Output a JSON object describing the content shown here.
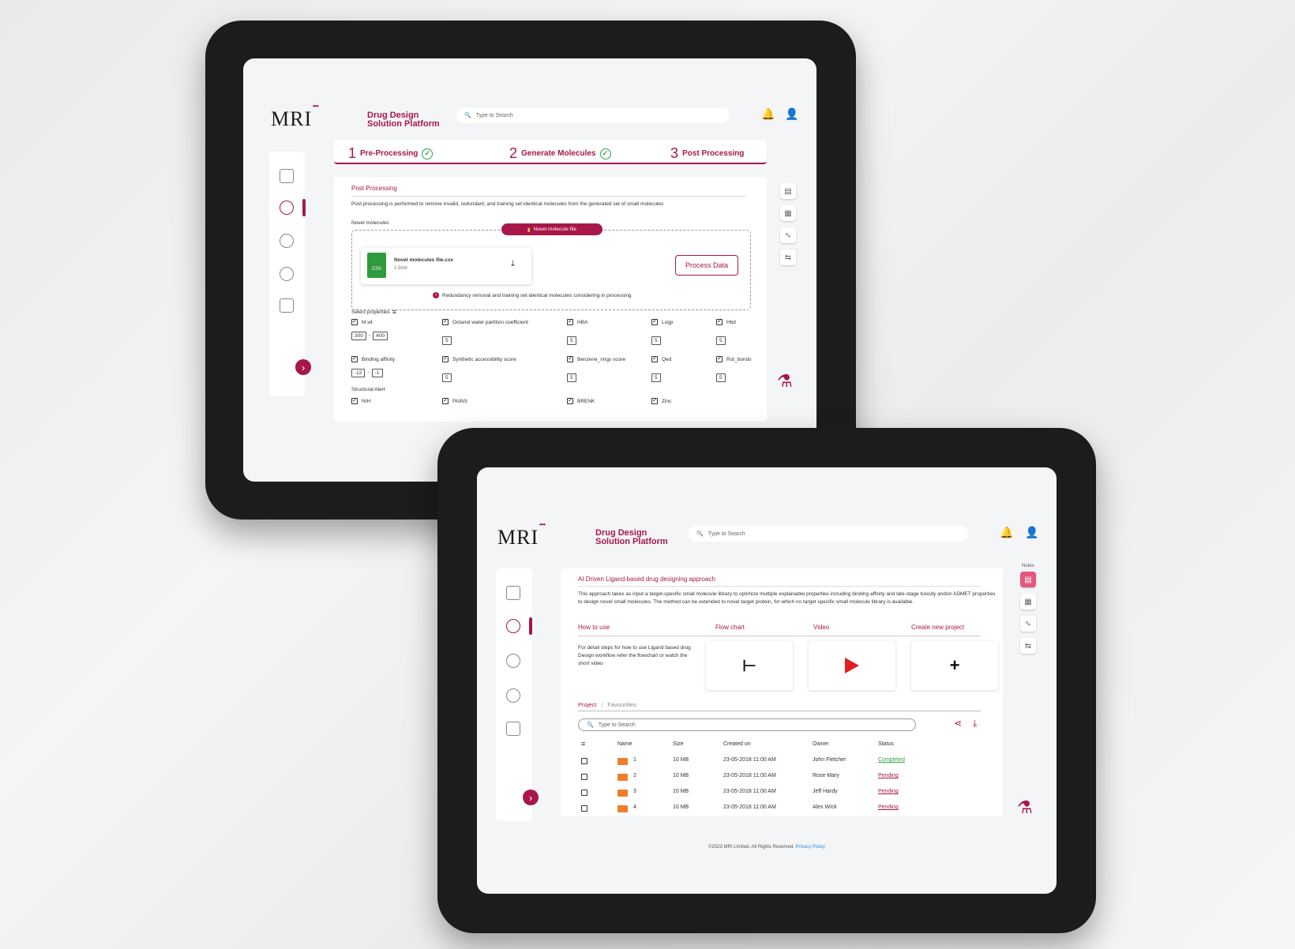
{
  "common": {
    "logo": "MRI",
    "brand_line1": "Drug Design",
    "brand_line2": "Solution Platform",
    "search_placeholder": "Type to Search",
    "accent": "#a8164a"
  },
  "top": {
    "steps": [
      {
        "num": "1",
        "label": "Pre-Processing"
      },
      {
        "num": "2",
        "label": "Generate Molecules"
      },
      {
        "num": "3",
        "label": "Post Processing"
      }
    ],
    "section_title": "Post Processing",
    "description": "Post processing is performed to remove invalid, redundant, and training set identical molecules from the generated set of small molecules",
    "novel_label": "Novel molecules",
    "novel_tab": "Novel molecule file",
    "file_name": "Novel molecules file.csv",
    "file_size": "1.5mb",
    "file_badge": "CSV",
    "process_button": "Process Data",
    "info_text": "Redundancy removal and training set identical molecules considering in processing",
    "select_properties": "Select properties",
    "structural_alert": "Structural Alert",
    "row1": [
      {
        "label": "M.wt",
        "v1": "300",
        "v2": "400"
      },
      {
        "label": "Octanol water partition coefficient",
        "v1": "5"
      },
      {
        "label": "HBA",
        "v1": "5"
      },
      {
        "label": "Logp",
        "v1": "5"
      },
      {
        "label": "Hbd",
        "v1": "5"
      }
    ],
    "row2": [
      {
        "label": "Binding affinity",
        "v1": "-12",
        "v2": "-1"
      },
      {
        "label": "Synthetic accessibility score",
        "v1": "5"
      },
      {
        "label": "Benzene_rings score",
        "v1": "5"
      },
      {
        "label": "Qed",
        "v1": "5"
      },
      {
        "label": "Rot_bonds",
        "v1": "5"
      }
    ],
    "alerts": [
      "NIH",
      "PAINS",
      "BRENK",
      "Zinc"
    ]
  },
  "bottom": {
    "notes_label": "Notes",
    "section_title": "AI Driven Ligand-based drug designing approach",
    "description": "This approach takes as input a target-specific small molecule library to optimize multiple explainable properties including binding affinity and late-stage toxicity and/or ADMET properties to design novel small molecules. The method can be extended to novel target protein, for which no target specific small molecule library is available.",
    "headers": [
      "How to use",
      "Flow chart",
      "Video",
      "Create new project"
    ],
    "how_to_text": "For detail steps for how to use Ligand based drug Design workflow refer the flowchart or watch the short video",
    "tabs": [
      "Project",
      "Favourities"
    ],
    "table_columns": [
      "Name",
      "Size",
      "Created on",
      "Owner",
      "Status"
    ],
    "rows": [
      {
        "name": "1",
        "size": "10 MB",
        "created": "23-05-2018 11:00 AM",
        "owner": "John Fletcher",
        "status": "Completed"
      },
      {
        "name": "2",
        "size": "10 MB",
        "created": "23-05-2018 11:00 AM",
        "owner": "Rose Mary",
        "status": "Pending"
      },
      {
        "name": "3",
        "size": "10 MB",
        "created": "23-05-2018 11:00 AM",
        "owner": "Jeff Hardy",
        "status": "Pending"
      },
      {
        "name": "4",
        "size": "10 MB",
        "created": "23-05-2018 11:00 AM",
        "owner": "Alex Wick",
        "status": "Pending"
      }
    ],
    "footer": "©2023 MRI Limited. All Rights Reserved.",
    "footer_link": "Privacy Policy"
  }
}
